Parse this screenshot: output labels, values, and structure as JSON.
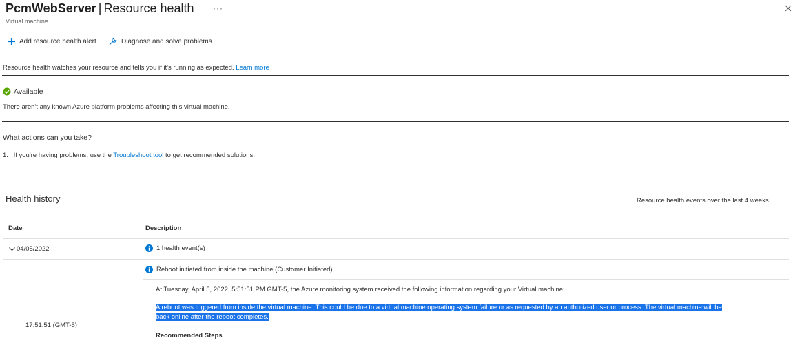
{
  "header": {
    "resource_name": "PcmWebServer",
    "separator": "|",
    "blade_title": "Resource health",
    "more_label": "···",
    "subtitle": "Virtual machine"
  },
  "toolbar": {
    "add_alert_label": "Add resource health alert",
    "diagnose_label": "Diagnose and solve problems"
  },
  "intro": {
    "text": "Resource health watches your resource and tells you if it's running as expected.",
    "learn_more": "Learn more"
  },
  "status": {
    "label": "Available",
    "description": "There aren't any known Azure platform problems affecting this virtual machine.",
    "color": "#57a300"
  },
  "actions": {
    "title": "What actions can you take?",
    "item_number": "1.",
    "item_prefix": "If you're having problems, use the",
    "item_link": "Troubleshoot tool",
    "item_suffix": "to get recommended solutions."
  },
  "history": {
    "title": "Health history",
    "range": "Resource health events over the last 4 weeks",
    "columns": {
      "date": "Date",
      "description": "Description"
    },
    "group": {
      "date": "04/05/2022",
      "events_count": "1 health event(s)"
    },
    "event": {
      "title": "Reboot initiated from inside the machine (Customer Initiated)",
      "intro": "At Tuesday, April 5, 2022, 5:51:51 PM GMT-5, the Azure monitoring system received the following information regarding your Virtual machine:",
      "message_line1": "A reboot was triggered from inside the virtual machine. This could be due to a virtual machine operating system failure or as requested by an authorized user or process. The virtual machine will be",
      "message_line2": "back online after the reboot completes.",
      "time": "17:51:51 (GMT-5)",
      "recommended_steps": "Recommended Steps"
    }
  },
  "colors": {
    "accent": "#0078d4",
    "selection": "#1a73e8",
    "info": "#0078d4"
  }
}
